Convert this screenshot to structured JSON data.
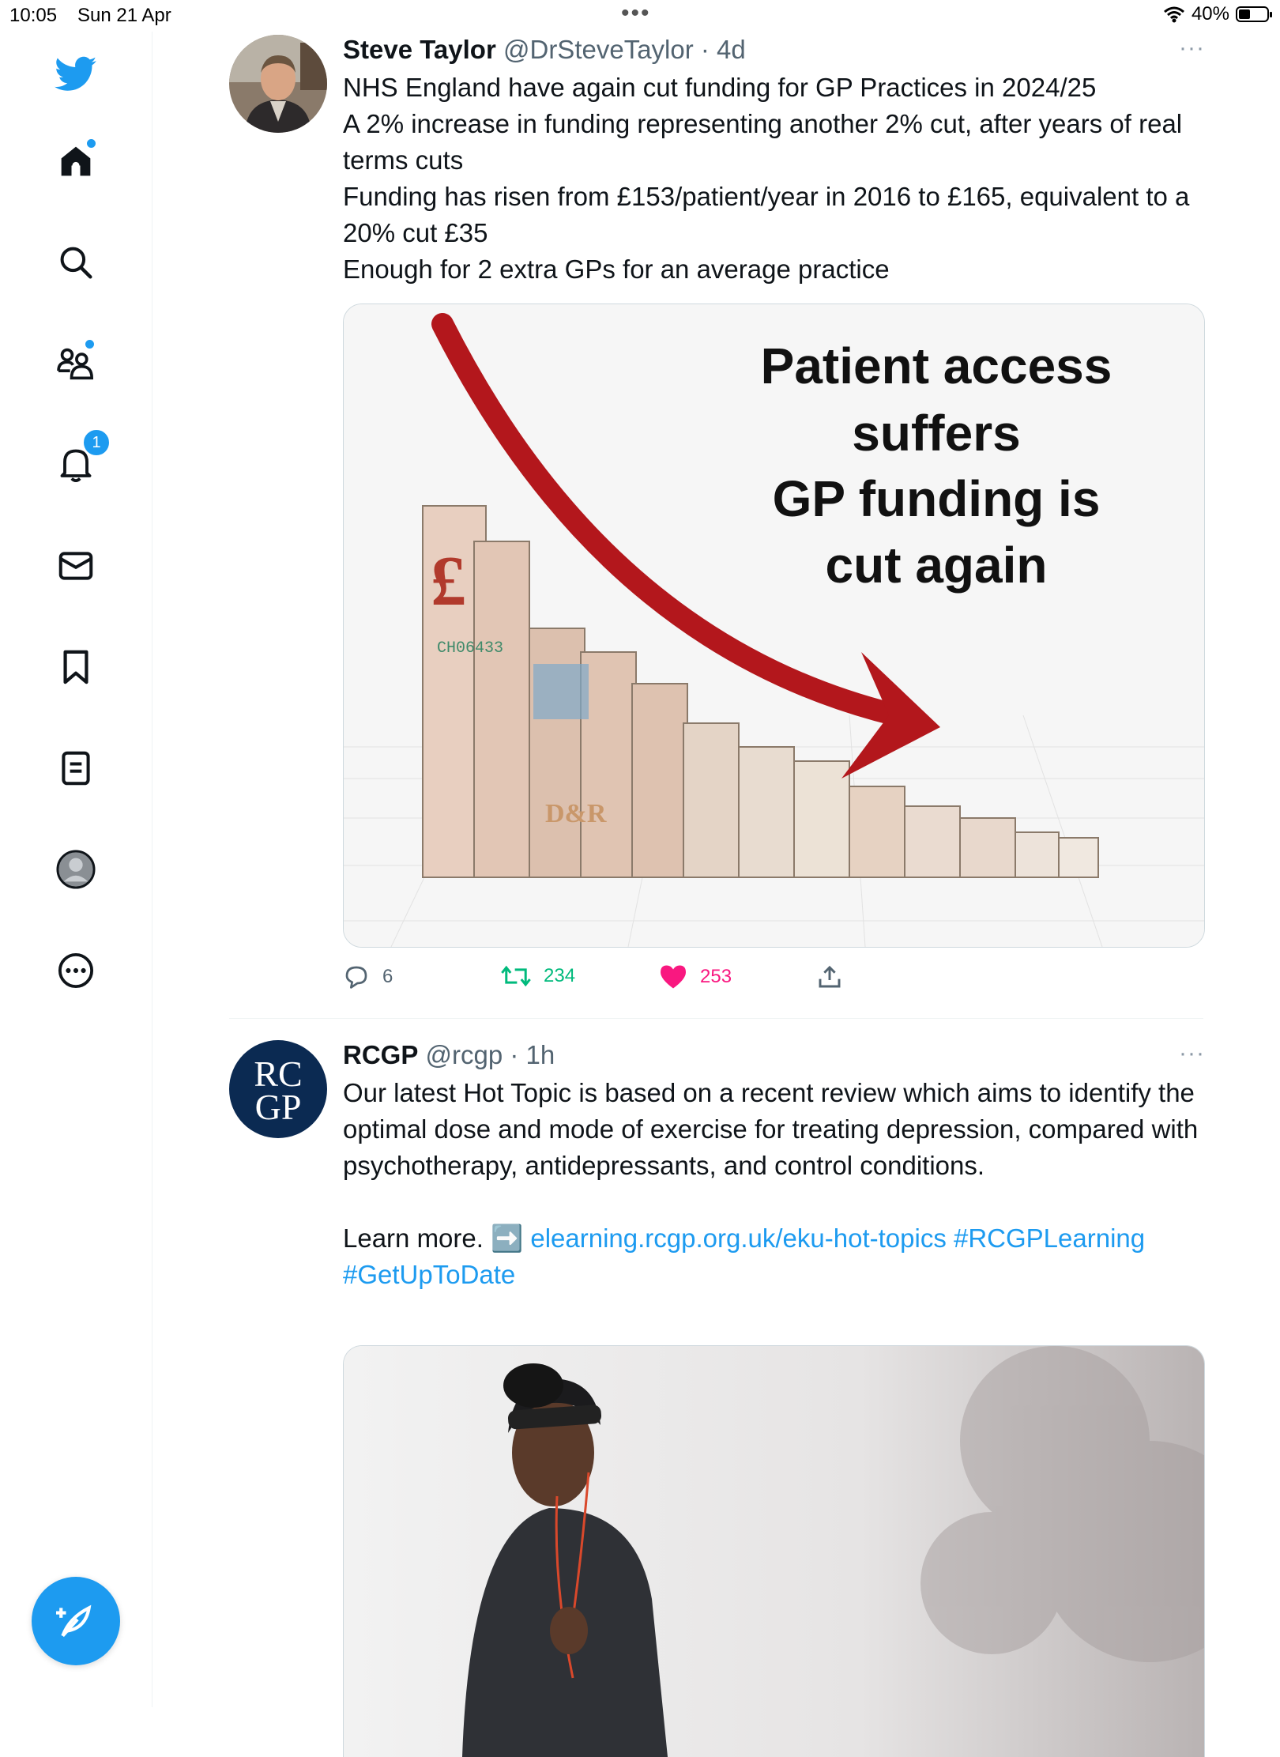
{
  "status_bar": {
    "time": "10:05",
    "date": "Sun 21 Apr",
    "battery": "40%"
  },
  "sidebar": {
    "items": [
      {
        "icon": "twitter-bird-icon"
      },
      {
        "icon": "home-icon",
        "indicator": true
      },
      {
        "icon": "search-icon"
      },
      {
        "icon": "communities-icon",
        "indicator": true
      },
      {
        "icon": "notifications-bell-icon",
        "badge": "1"
      },
      {
        "icon": "messages-envelope-icon"
      },
      {
        "icon": "bookmark-icon"
      },
      {
        "icon": "lists-icon"
      },
      {
        "icon": "profile-avatar-icon"
      },
      {
        "icon": "more-options-icon"
      }
    ],
    "compose_icon": "compose-feather-icon",
    "notification_badge": "1"
  },
  "tweets": [
    {
      "name": "Steve Taylor",
      "handle": "@DrSteveTaylor",
      "time": "· 4d",
      "more": "···",
      "body": [
        "NHS England have again cut funding for GP Practices in 2024/25",
        "A 2% increase in funding representing another 2% cut, after years of real terms cuts",
        "Funding has risen from £153/patient/year in 2016 to £165, equivalent to a 20% cut £35",
        "Enough for 2 extra GPs for an average practice"
      ],
      "image": {
        "headline_lines": [
          "Patient access",
          "suffers",
          "GP funding is",
          "cut again"
        ],
        "note_text_1": "£",
        "note_text_2": "CH06433",
        "note_text_3": "D&R"
      },
      "replies": "6",
      "retweets": "234",
      "likes": "253"
    },
    {
      "name": "RCGP",
      "handle": "@rcgp",
      "time": "· 1h",
      "more": "···",
      "avatar_text_1": "RC",
      "avatar_text_2": "GP",
      "body": "Our latest Hot Topic is based on a recent review which aims to identify the optimal dose and mode of exercise for treating depression, compared with psychotherapy, antidepressants, and control conditions.",
      "learn_more": "Learn more. ➡️",
      "link": "elearning.rcgp.org.uk/eku-hot-topics",
      "hashtag1": "#RCGPLearning",
      "hashtag2": "#GetUpToDate"
    }
  ],
  "colors": {
    "accent": "#1d9bf0",
    "like": "#f91880",
    "retweet": "#00ba7c",
    "text": "#0f1419",
    "muted": "#536471"
  }
}
